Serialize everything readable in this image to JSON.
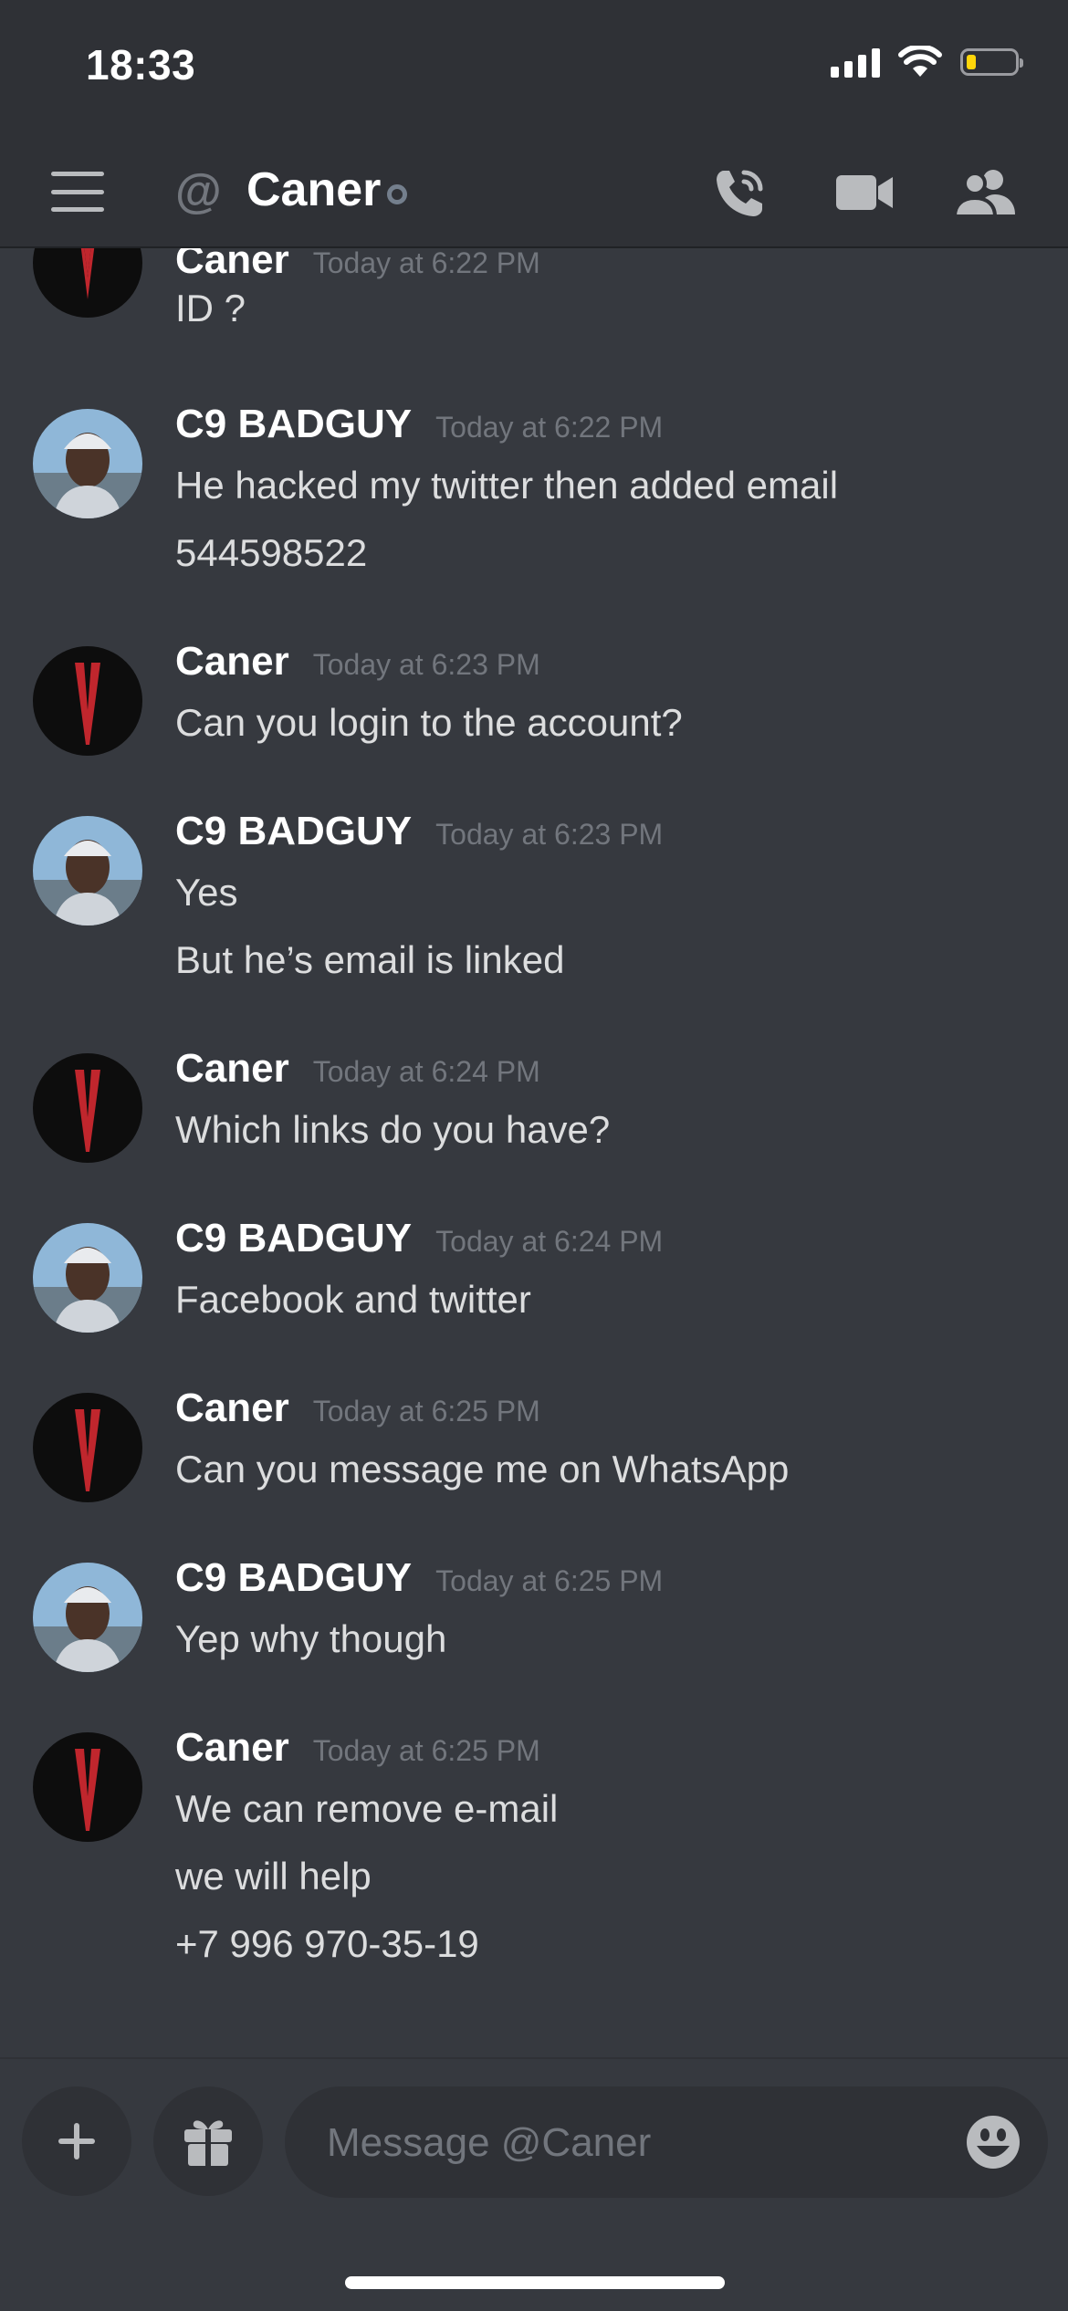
{
  "status_bar": {
    "time": "18:33"
  },
  "header": {
    "at_symbol": "@",
    "title": "Caner"
  },
  "messages": [
    {
      "author": "Caner",
      "timestamp": "Today at 6:22 PM",
      "lines": [
        "ID ?"
      ]
    },
    {
      "author": "C9 BADGUY",
      "timestamp": "Today at 6:22 PM",
      "lines": [
        "He hacked my twitter then added email",
        "544598522"
      ]
    },
    {
      "author": "Caner",
      "timestamp": "Today at 6:23 PM",
      "lines": [
        "Can you login to the account?"
      ]
    },
    {
      "author": "C9 BADGUY",
      "timestamp": "Today at 6:23 PM",
      "lines": [
        "Yes",
        "But he’s email is linked"
      ]
    },
    {
      "author": "Caner",
      "timestamp": "Today at 6:24 PM",
      "lines": [
        "Which links do you have?"
      ]
    },
    {
      "author": "C9 BADGUY",
      "timestamp": "Today at 6:24 PM",
      "lines": [
        "Facebook and twitter"
      ]
    },
    {
      "author": "Caner",
      "timestamp": "Today at 6:25 PM",
      "lines": [
        "Can you message me on WhatsApp"
      ]
    },
    {
      "author": "C9 BADGUY",
      "timestamp": "Today at 6:25 PM",
      "lines": [
        "Yep why though"
      ]
    },
    {
      "author": "Caner",
      "timestamp": "Today at 6:25 PM",
      "lines": [
        "We can remove e-mail",
        "we will help",
        "+7 996 970-35-19"
      ]
    }
  ],
  "composer": {
    "placeholder": "Message @Caner"
  },
  "icons": {
    "menu": "hamburger-menu-icon",
    "call": "phone-call-icon",
    "video": "video-camera-icon",
    "members": "members-icon",
    "add": "plus-icon",
    "gift": "gift-icon",
    "emoji": "emoji-icon"
  },
  "colors": {
    "background": "#36393f",
    "header": "#2f3136",
    "text": "#dcddde",
    "muted": "#72767d",
    "battery": "#ffd60a"
  }
}
